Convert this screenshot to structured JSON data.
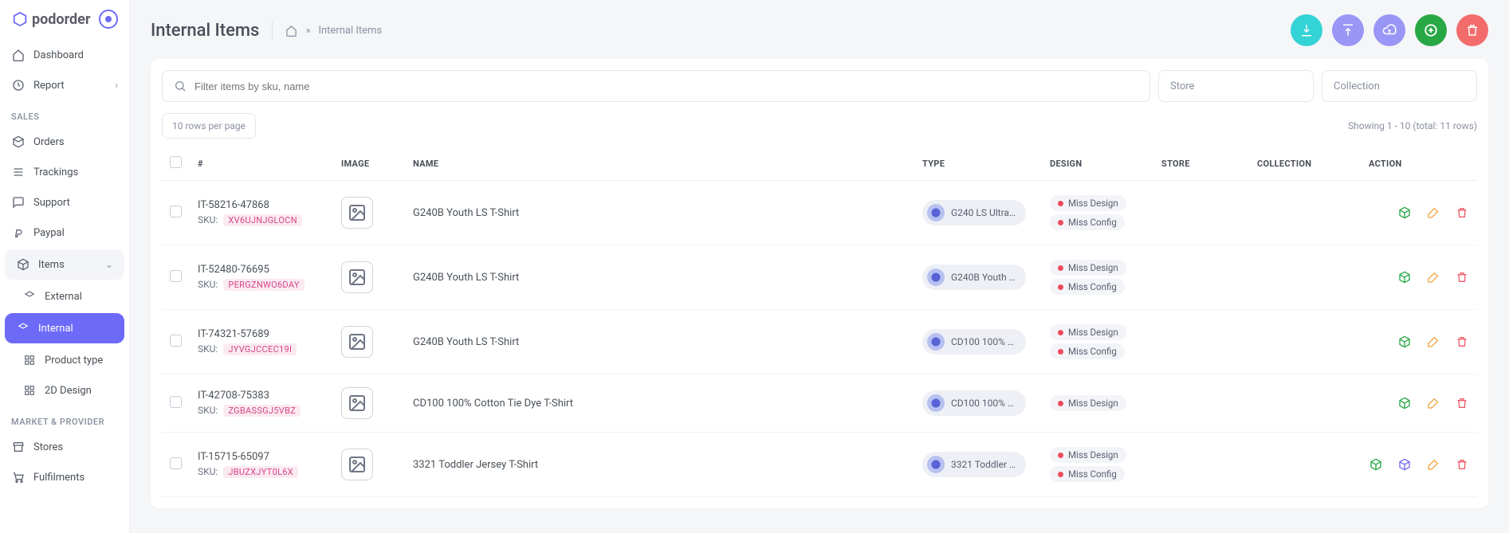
{
  "brand": {
    "name": "podorder"
  },
  "sidebar": {
    "main": [
      {
        "label": "Dashboard"
      },
      {
        "label": "Report"
      }
    ],
    "section_sales": "SALES",
    "sales": [
      {
        "label": "Orders"
      },
      {
        "label": "Trackings"
      },
      {
        "label": "Support"
      },
      {
        "label": "Paypal"
      },
      {
        "label": "Items"
      }
    ],
    "items_sub": [
      {
        "label": "External"
      },
      {
        "label": "Internal"
      },
      {
        "label": "Product type"
      },
      {
        "label": "2D Design"
      }
    ],
    "section_market": "MARKET & PROVIDER",
    "market": [
      {
        "label": "Stores"
      },
      {
        "label": "Fulfilments"
      }
    ]
  },
  "header": {
    "title": "Internal Items",
    "breadcrumb_current": "Internal Items"
  },
  "filters": {
    "search_placeholder": "Filter items by sku, name",
    "store_placeholder": "Store",
    "collection_placeholder": "Collection"
  },
  "pagination": {
    "rows_label": "10 rows per page",
    "showing": "Showing 1 - 10 (total: 11 rows)"
  },
  "table": {
    "headers": {
      "hash": "#",
      "image": "IMAGE",
      "name": "NAME",
      "type": "TYPE",
      "design": "DESIGN",
      "store": "STORE",
      "collection": "COLLECTION",
      "action": "ACTION"
    },
    "sku_prefix": "SKU:",
    "rows": [
      {
        "id": "IT-58216-47868",
        "sku": "XV6UJNJGLOCN",
        "name": "G240B Youth LS T-Shirt",
        "type": "G240 LS Ultra C...",
        "design": [
          "Miss Design",
          "Miss Config"
        ],
        "actions": [
          "box",
          "edit",
          "trash"
        ]
      },
      {
        "id": "IT-52480-76695",
        "sku": "PERGZNWO6DAY",
        "name": "G240B Youth LS T-Shirt",
        "type": "G240B Youth L...",
        "design": [
          "Miss Design",
          "Miss Config"
        ],
        "actions": [
          "box",
          "edit",
          "trash"
        ]
      },
      {
        "id": "IT-74321-57689",
        "sku": "JYVGJCCEC19I",
        "name": "G240B Youth LS T-Shirt",
        "type": "CD100 100% C...",
        "design": [
          "Miss Design",
          "Miss Config"
        ],
        "actions": [
          "box",
          "edit",
          "trash"
        ]
      },
      {
        "id": "IT-42708-75383",
        "sku": "ZGBASSGJ5VBZ",
        "name": "CD100 100% Cotton Tie Dye T-Shirt",
        "type": "CD100 100% C...",
        "design": [
          "Miss Design"
        ],
        "actions": [
          "box",
          "edit",
          "trash"
        ]
      },
      {
        "id": "IT-15715-65097",
        "sku": "JBUZXJYT0L6X",
        "name": "3321 Toddler Jersey T-Shirt",
        "type": "3321 Toddler Je...",
        "design": [
          "Miss Design",
          "Miss Config"
        ],
        "actions": [
          "box",
          "box2",
          "edit",
          "trash"
        ]
      }
    ]
  }
}
